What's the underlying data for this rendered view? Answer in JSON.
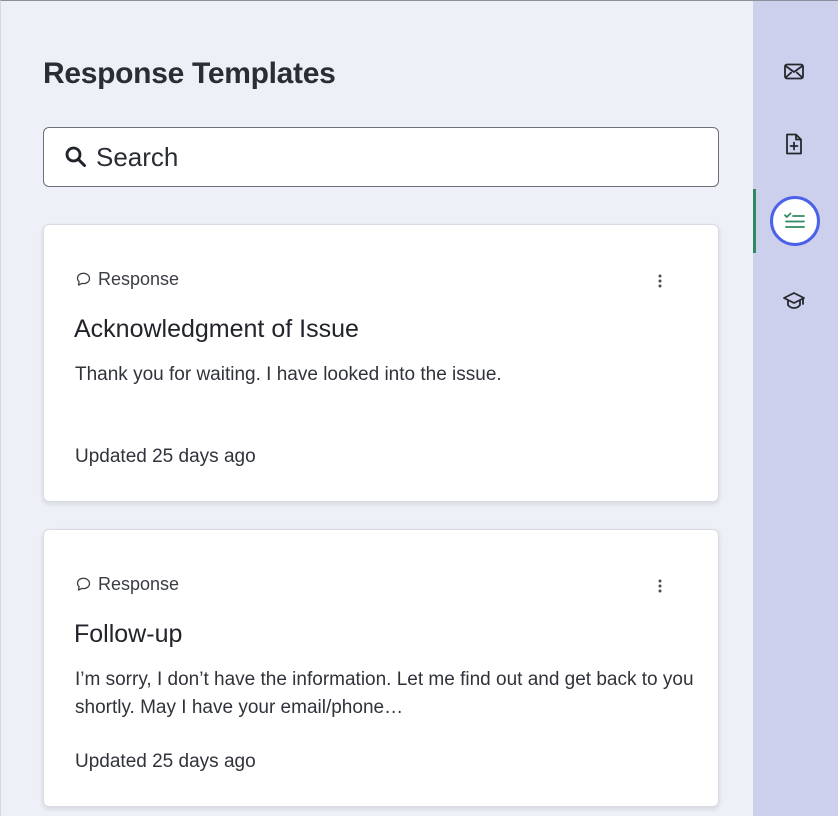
{
  "panel": {
    "title": "Response Templates"
  },
  "search": {
    "placeholder": "Search",
    "icon": "search-icon"
  },
  "templates": [
    {
      "type_label": "Response",
      "type_icon": "speech-bubble-icon",
      "title": "Acknowledgment of Issue",
      "body": "Thank you for waiting. I have looked into the issue.",
      "updated": "Updated 25 days ago",
      "menu_icon": "more-vertical-icon"
    },
    {
      "type_label": "Response",
      "type_icon": "speech-bubble-icon",
      "title": "Follow-up",
      "body": "I’m sorry, I don’t have the information. Let me find out and get back to you shortly. May I have your email/phone…",
      "updated": "Updated 25 days ago",
      "menu_icon": "more-vertical-icon"
    }
  ],
  "rail": {
    "items": [
      {
        "icon": "mail-icon",
        "active": false
      },
      {
        "icon": "file-plus-icon",
        "active": false
      },
      {
        "icon": "checklist-icon",
        "active": true
      },
      {
        "icon": "graduation-cap-icon",
        "active": false
      }
    ],
    "colors": {
      "rail_background": "#cdd0ed",
      "active_ring": "#4a61e8",
      "active_indicator": "#2f8a61",
      "active_icon": "#2f8a61"
    }
  }
}
